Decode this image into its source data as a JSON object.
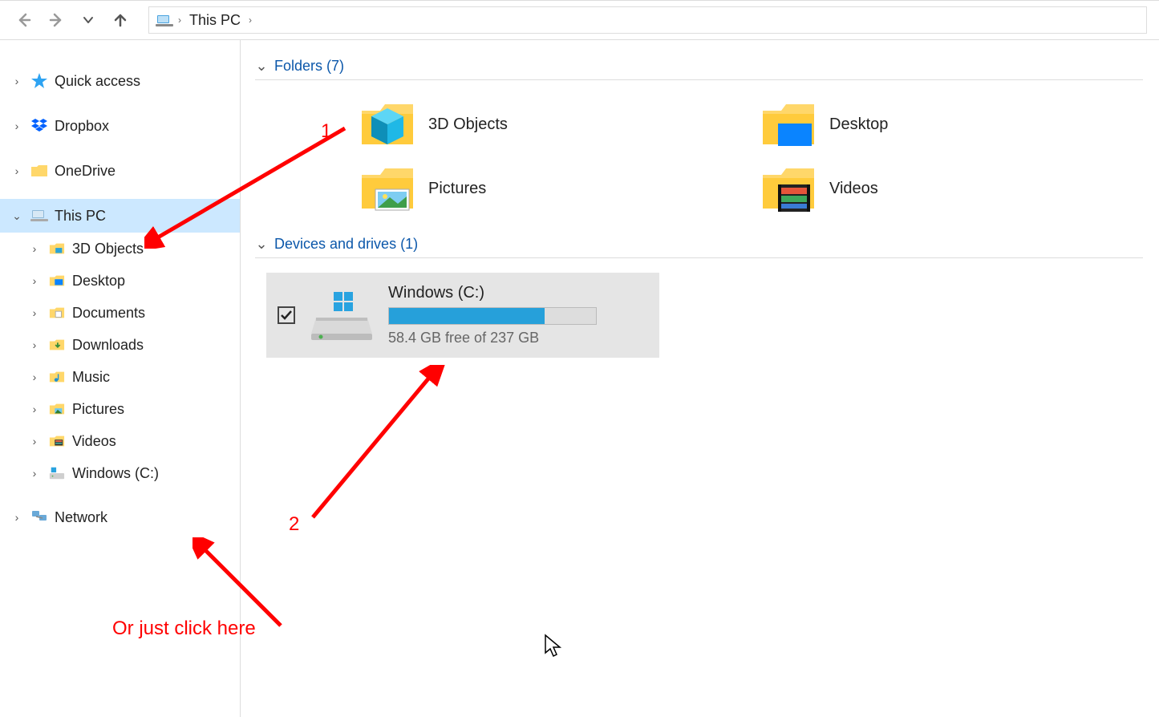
{
  "address": {
    "crumb": "This PC"
  },
  "sidebar": {
    "items": [
      {
        "label": "Quick access"
      },
      {
        "label": "Dropbox"
      },
      {
        "label": "OneDrive"
      },
      {
        "label": "This PC"
      },
      {
        "label": "Network"
      }
    ],
    "thispc_children": [
      {
        "label": "3D Objects"
      },
      {
        "label": "Desktop"
      },
      {
        "label": "Documents"
      },
      {
        "label": "Downloads"
      },
      {
        "label": "Music"
      },
      {
        "label": "Pictures"
      },
      {
        "label": "Videos"
      },
      {
        "label": "Windows (C:)"
      }
    ]
  },
  "sections": {
    "folders_header": "Folders (7)",
    "drives_header": "Devices and drives (1)"
  },
  "folders": [
    {
      "label": "3D Objects"
    },
    {
      "label": "Desktop"
    },
    {
      "label": "Pictures"
    },
    {
      "label": "Videos"
    }
  ],
  "drive": {
    "name": "Windows (C:)",
    "free_text": "58.4 GB free of 237 GB",
    "fill_percent": 75
  },
  "annotations": {
    "one": "1",
    "two": "2",
    "hint": "Or just click here"
  }
}
